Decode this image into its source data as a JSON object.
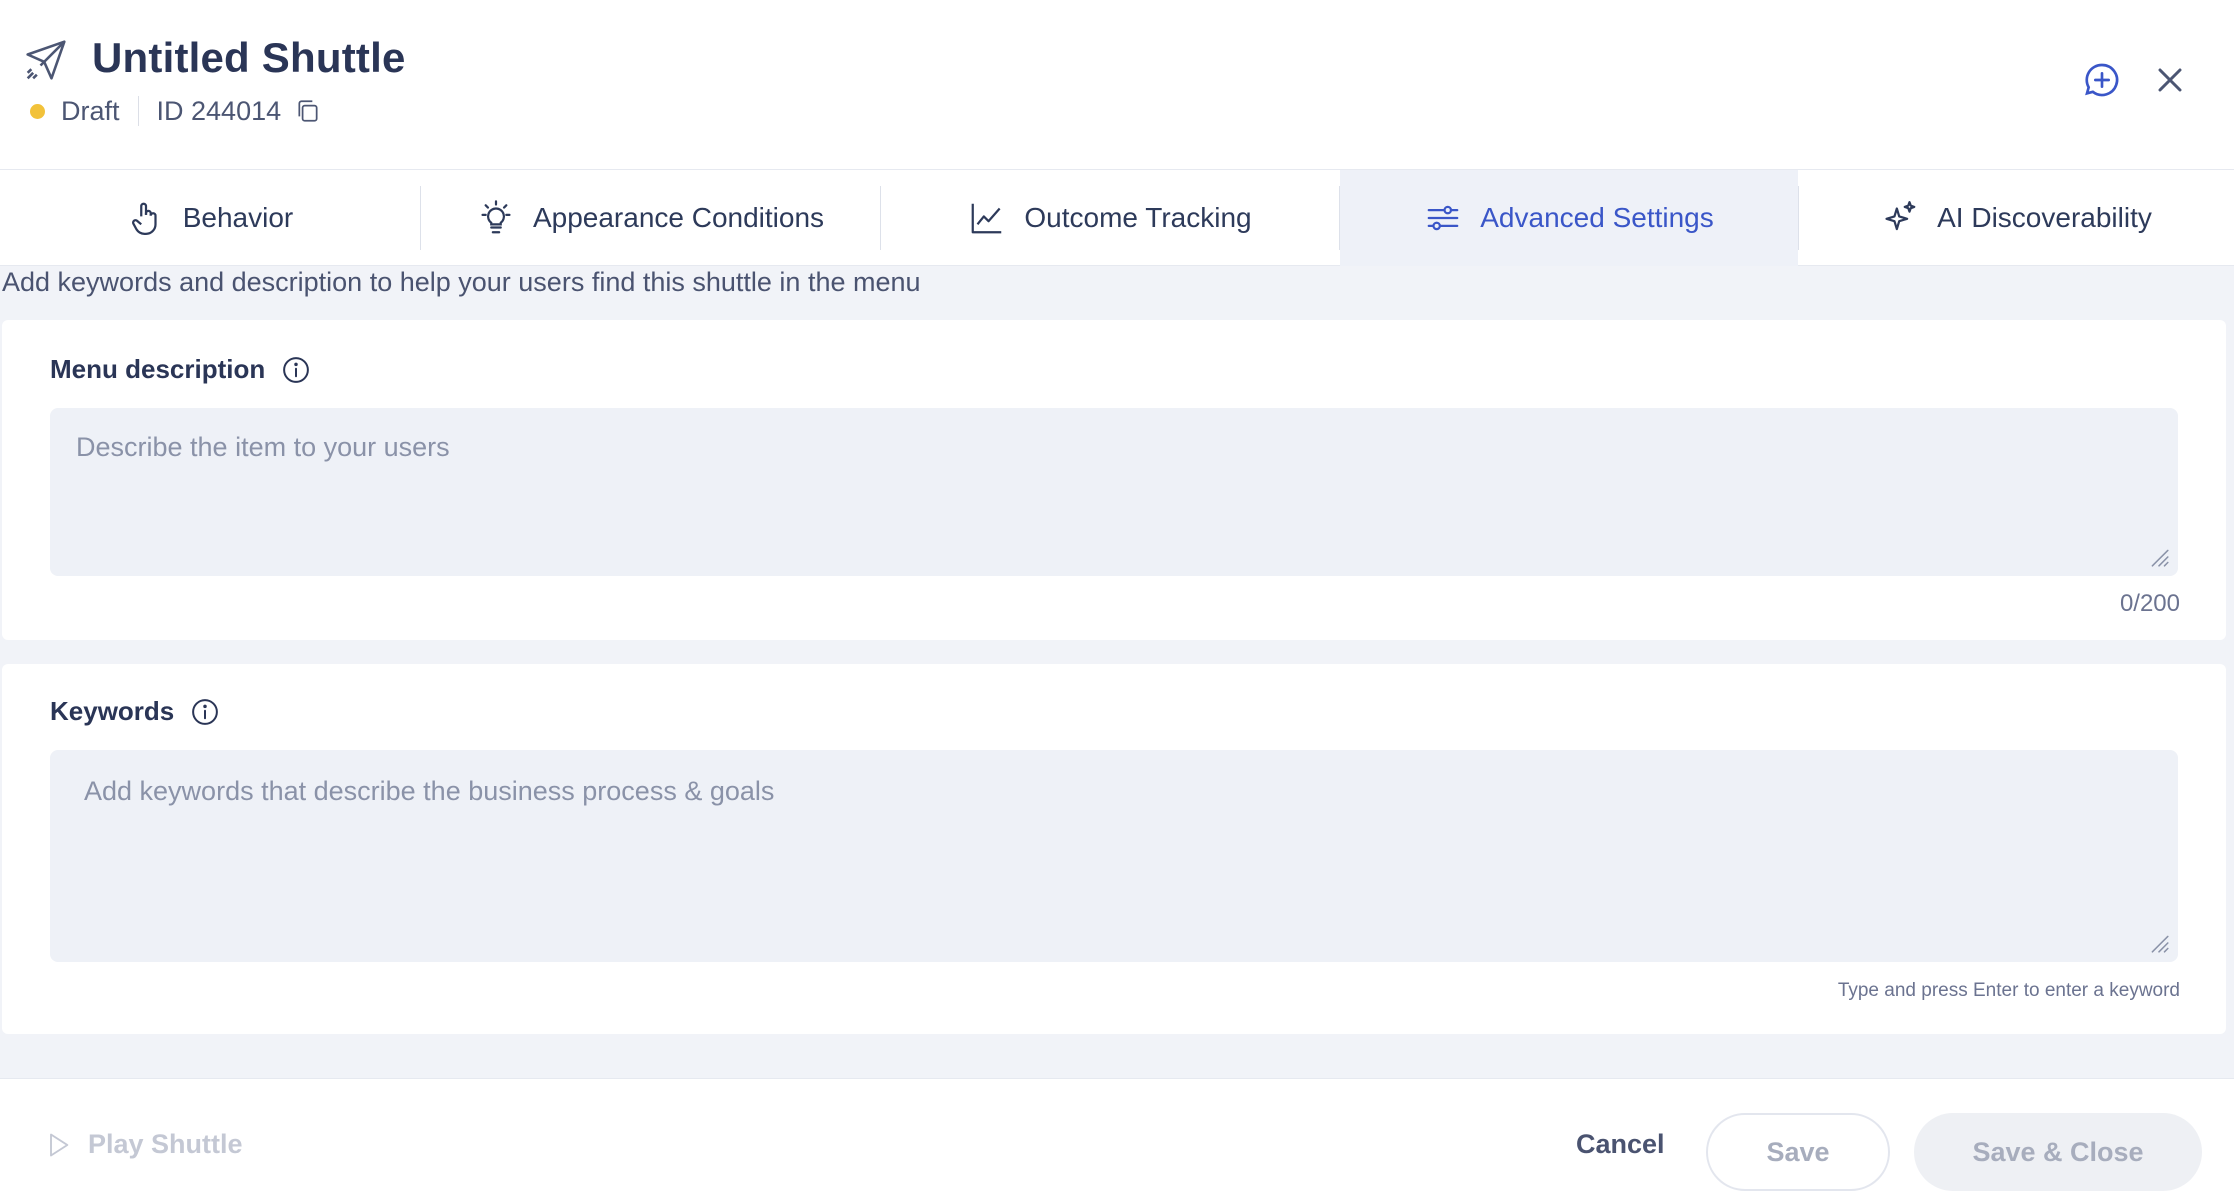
{
  "header": {
    "title": "Untitled Shuttle",
    "status": "Draft",
    "id_label": "ID 244014",
    "status_color": "#f2c23a"
  },
  "icons": {
    "title": "paper-plane-icon",
    "copy": "copy-icon",
    "add_comment": "add-comment-icon",
    "close": "close-icon"
  },
  "tabs": [
    {
      "label": "Behavior",
      "icon": "hand-pointer-icon",
      "active": false
    },
    {
      "label": "Appearance Conditions",
      "icon": "lightbulb-icon",
      "active": false
    },
    {
      "label": "Outcome Tracking",
      "icon": "line-chart-icon",
      "active": false
    },
    {
      "label": "Advanced Settings",
      "icon": "sliders-icon",
      "active": true
    },
    {
      "label": "AI Discoverability",
      "icon": "sparkles-icon",
      "active": false
    }
  ],
  "main": {
    "intro": "Add keywords and description to help your users find this shuttle in the menu",
    "menu_description": {
      "label": "Menu description",
      "placeholder": "Describe the item to your users",
      "value": "",
      "counter": "0/200"
    },
    "keywords": {
      "label": "Keywords",
      "placeholder": "Add keywords that describe the business process & goals",
      "value": "",
      "hint": "Type and press Enter to enter a keyword"
    }
  },
  "footer": {
    "play": "Play Shuttle",
    "cancel": "Cancel",
    "save": "Save",
    "save_close": "Save & Close"
  },
  "colors": {
    "accent": "#3a56c8",
    "active_tab_bg": "#eef1f8",
    "page_bg": "#f1f3f8"
  }
}
